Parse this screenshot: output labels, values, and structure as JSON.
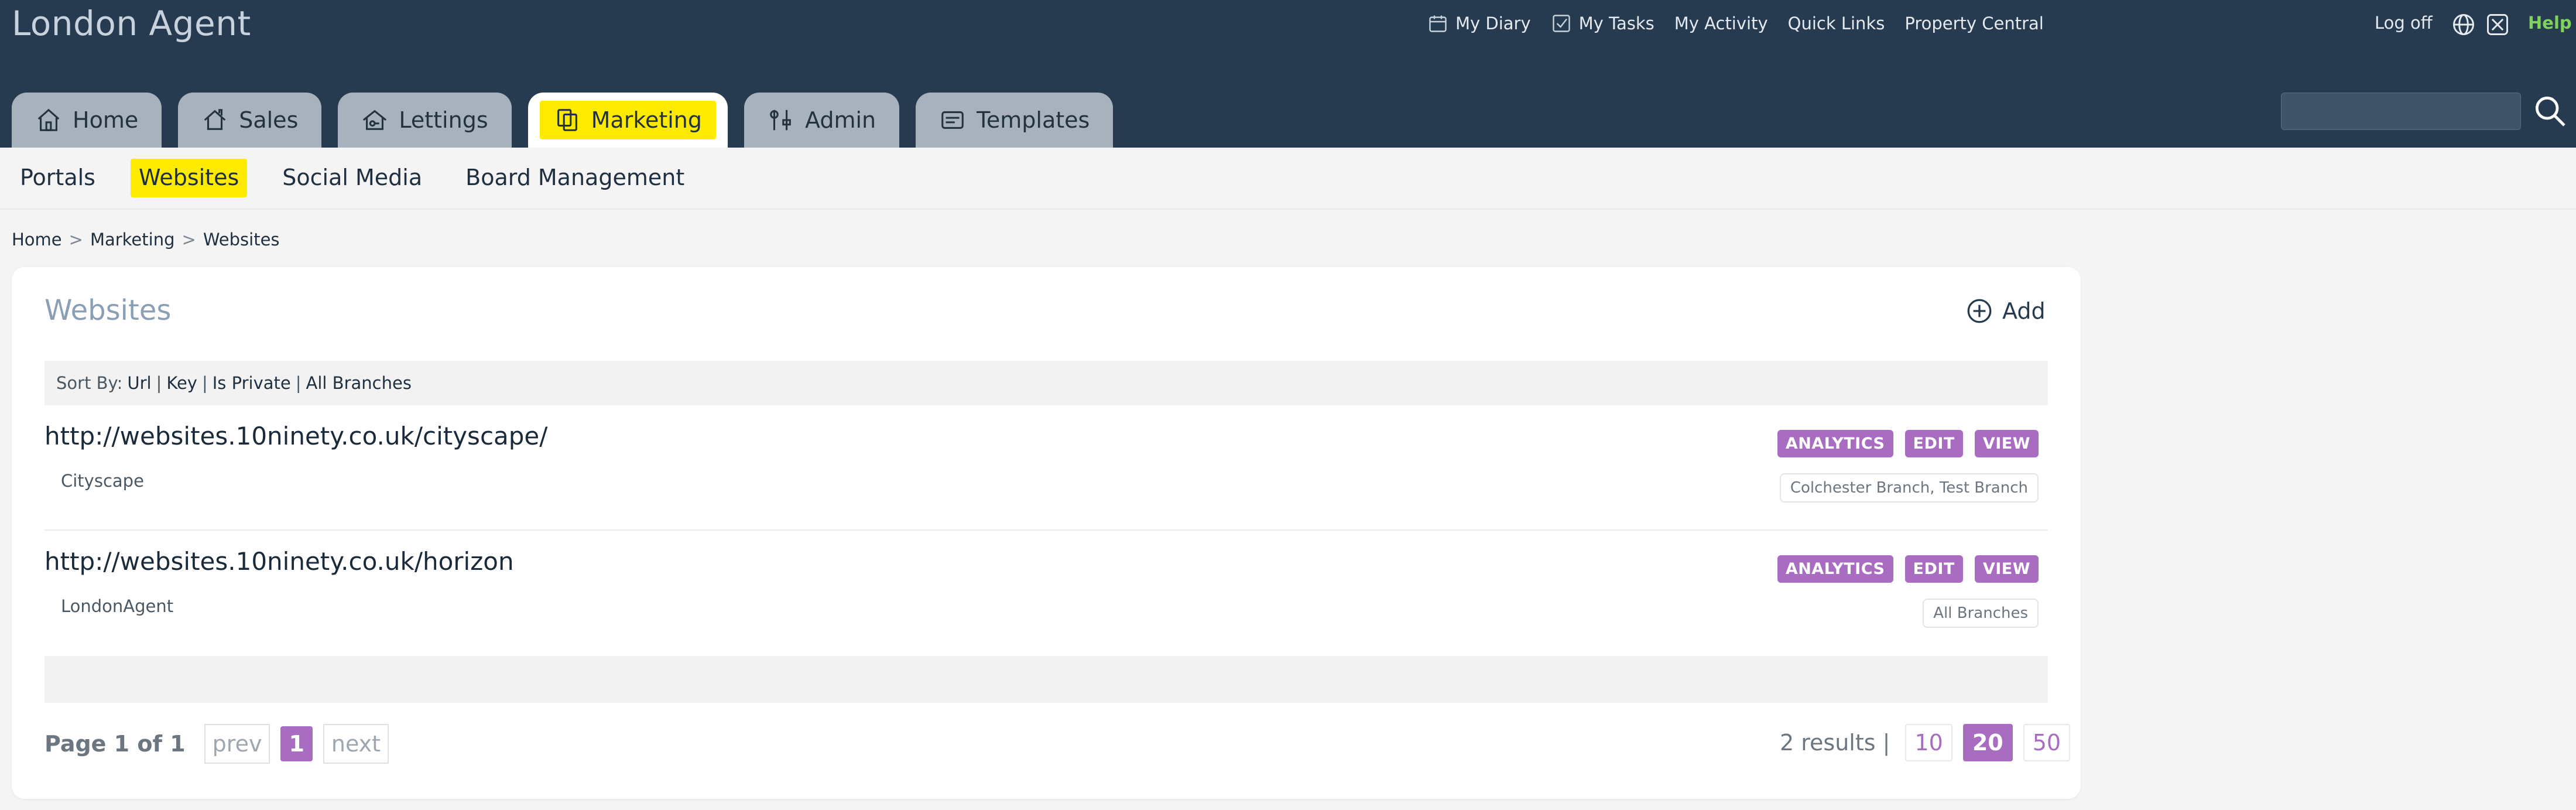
{
  "app": {
    "title": "London Agent"
  },
  "top_links": {
    "diary": "My Diary",
    "tasks": "My Tasks",
    "activity": "My Activity",
    "quick_links": "Quick Links",
    "property_central": "Property Central",
    "logoff": "Log off",
    "help": "Help"
  },
  "tabs": {
    "home": "Home",
    "sales": "Sales",
    "lettings": "Lettings",
    "marketing": "Marketing",
    "admin": "Admin",
    "templates": "Templates"
  },
  "search": {
    "value": ""
  },
  "subnav": {
    "portals": "Portals",
    "websites": "Websites",
    "social_media": "Social Media",
    "board_management": "Board Management"
  },
  "breadcrumb": {
    "home": "Home",
    "marketing": "Marketing",
    "current": "Websites",
    "separator": ">"
  },
  "card": {
    "title": "Websites",
    "add_label": "Add",
    "sort": {
      "prefix": "Sort By:",
      "url": "Url",
      "key": "Key",
      "is_private": "Is Private",
      "all_branches": "All Branches",
      "pipe": "|"
    },
    "rows": [
      {
        "url": "http://websites.10ninety.co.uk/cityscape/",
        "key": "Cityscape",
        "branches": "Colchester Branch, Test Branch"
      },
      {
        "url": "http://websites.10ninety.co.uk/horizon",
        "key": "LondonAgent",
        "branches": "All Branches"
      }
    ],
    "actions": {
      "analytics": "ANALYTICS",
      "edit": "EDIT",
      "view": "VIEW"
    }
  },
  "pagination": {
    "info": "Page 1 of 1",
    "prev": "prev",
    "current": "1",
    "next": "next",
    "results": "2 results |",
    "sizes": [
      "10",
      "20",
      "50"
    ],
    "selected_size": "20"
  },
  "colors": {
    "header_bg": "#263b4f",
    "highlight": "#ffeb00",
    "accent": "#a86cc1",
    "help": "#7fd25c"
  }
}
